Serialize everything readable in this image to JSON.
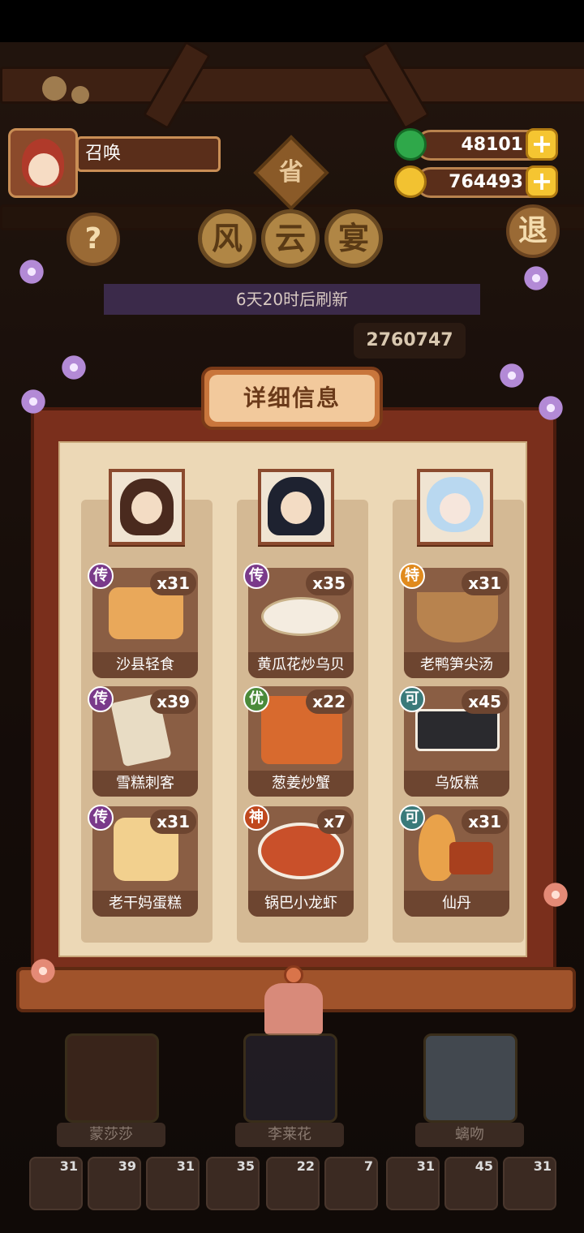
{
  "player": {
    "name": "召唤"
  },
  "currency": {
    "jade": "48101",
    "coins": "764493",
    "plus": "+"
  },
  "buttons": {
    "help": "?",
    "exit": "退",
    "province": "省"
  },
  "event": {
    "title_chars": [
      "风",
      "云",
      "宴"
    ],
    "refresh": "6天20时后刷新",
    "score": "2760747"
  },
  "panel": {
    "title": "详细信息",
    "columns": [
      {
        "dishes": [
          {
            "name": "沙县轻食",
            "qty": "x31",
            "rank": "传",
            "rank_color": "#7a3a8a"
          },
          {
            "name": "雪糕刺客",
            "qty": "x39",
            "rank": "传",
            "rank_color": "#7a3a8a"
          },
          {
            "name": "老干妈蛋糕",
            "qty": "x31",
            "rank": "传",
            "rank_color": "#7a3a8a"
          }
        ]
      },
      {
        "dishes": [
          {
            "name": "黄瓜花炒乌贝",
            "qty": "x35",
            "rank": "传",
            "rank_color": "#7a3a8a"
          },
          {
            "name": "葱姜炒蟹",
            "qty": "x22",
            "rank": "优",
            "rank_color": "#4a8a3a"
          },
          {
            "name": "锅巴小龙虾",
            "qty": "x7",
            "rank": "神",
            "rank_color": "#c0481e"
          }
        ]
      },
      {
        "dishes": [
          {
            "name": "老鸭笋尖汤",
            "qty": "x31",
            "rank": "特",
            "rank_color": "#e08a1e"
          },
          {
            "name": "乌饭糕",
            "qty": "x45",
            "rank": "可",
            "rank_color": "#3a7a7a"
          },
          {
            "name": "仙丹",
            "qty": "x31",
            "rank": "可",
            "rank_color": "#3a7a7a"
          }
        ]
      }
    ]
  },
  "bottom_chars": [
    "蒙莎莎",
    "李莱花",
    "螭吻"
  ],
  "bottom_slots": [
    "31",
    "39",
    "31",
    "35",
    "22",
    "7",
    "31",
    "45",
    "31"
  ]
}
